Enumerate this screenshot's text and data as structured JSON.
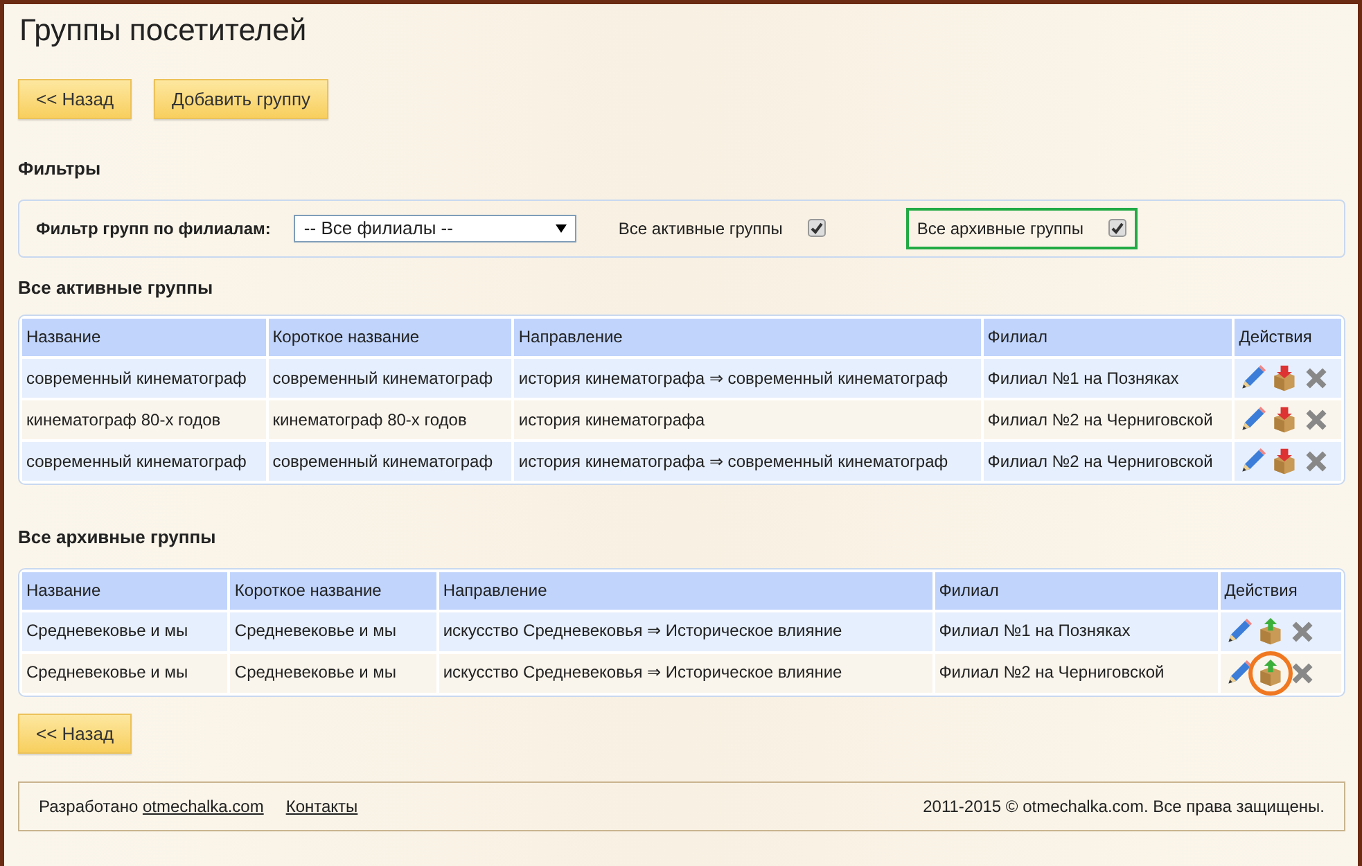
{
  "title": "Группы посетителей",
  "top_buttons": [
    "<< Назад",
    "Добавить группу"
  ],
  "filters": {
    "heading": "Фильтры",
    "branch_label": "Фильтр групп по филиалам:",
    "branch_value": "-- Все филиалы --",
    "checks": [
      {
        "label": "Все активные группы",
        "checked": true,
        "highlighted": false
      },
      {
        "label": "Все архивные группы",
        "checked": true,
        "highlighted": true
      }
    ]
  },
  "sections": [
    {
      "heading": "Все активные группы",
      "columns": [
        "Название",
        "Короткое название",
        "Направление",
        "Филиал",
        "Действия"
      ],
      "rows": [
        {
          "cells": [
            "современный кинематограф",
            "современный кинематограф",
            "история кинематографа ⇒ современный кинематограф",
            "Филиал №1 на Позняках"
          ],
          "actions": [
            {
              "kind": "edit",
              "circled": false
            },
            {
              "kind": "archive",
              "circled": false
            },
            {
              "kind": "delete",
              "circled": false
            }
          ]
        },
        {
          "cells": [
            "кинематограф 80-х годов",
            "кинематограф 80-х годов",
            "история кинематографа",
            "Филиал №2 на Черниговской"
          ],
          "actions": [
            {
              "kind": "edit",
              "circled": false
            },
            {
              "kind": "archive",
              "circled": false
            },
            {
              "kind": "delete",
              "circled": false
            }
          ]
        },
        {
          "cells": [
            "современный кинематограф",
            "современный кинематограф",
            "история кинематографа ⇒ современный кинематограф",
            "Филиал №2 на Черниговской"
          ],
          "actions": [
            {
              "kind": "edit",
              "circled": false
            },
            {
              "kind": "archive",
              "circled": false
            },
            {
              "kind": "delete",
              "circled": false
            }
          ]
        }
      ]
    },
    {
      "heading": "Все архивные группы",
      "columns": [
        "Название",
        "Короткое название",
        "Направление",
        "Филиал",
        "Действия"
      ],
      "rows": [
        {
          "cells": [
            "Средневековье и мы",
            "Средневековье и мы",
            "искусство Средневековья ⇒ Историческое влияние",
            "Филиал №1 на Позняках"
          ],
          "actions": [
            {
              "kind": "edit",
              "circled": false
            },
            {
              "kind": "unarchive",
              "circled": false
            },
            {
              "kind": "delete",
              "circled": false
            }
          ]
        },
        {
          "cells": [
            "Средневековье и мы",
            "Средневековье и мы",
            "искусство Средневековья ⇒ Историческое влияние",
            "Филиал №2 на Черниговской"
          ],
          "actions": [
            {
              "kind": "edit",
              "circled": false
            },
            {
              "kind": "unarchive",
              "circled": true
            },
            {
              "kind": "delete",
              "circled": false
            }
          ]
        }
      ]
    }
  ],
  "bottom_button": "<< Назад",
  "footer": {
    "developed": "Разработано",
    "site_link": "otmechalka.com",
    "contacts": "Контакты",
    "copyright": "2011-2015 © otmechalka.com. Все права защищены."
  }
}
